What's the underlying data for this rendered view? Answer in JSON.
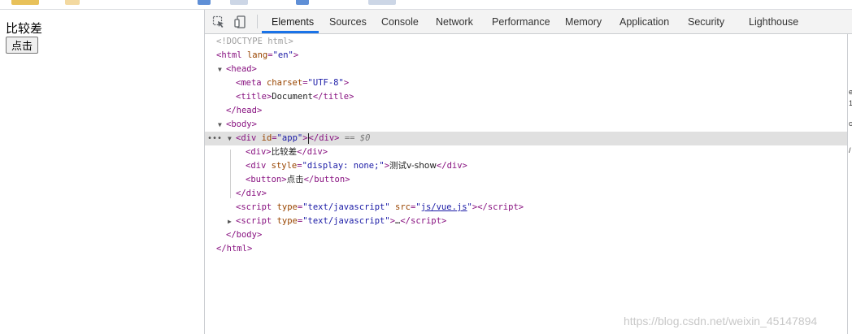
{
  "page": {
    "text": "比较差",
    "button_label": "点击"
  },
  "devtools": {
    "tabs": [
      "Elements",
      "Sources",
      "Console",
      "Network",
      "Performance",
      "Memory",
      "Application",
      "Security",
      "Lighthouse"
    ],
    "active_tab": "Elements",
    "tool_icons": [
      "inspect-element-icon",
      "device-toolbar-icon"
    ]
  },
  "dom": {
    "doctype": "<!DOCTYPE html>",
    "html_open_tag": "html",
    "html_lang_attr": "lang",
    "html_lang_val": "\"en\"",
    "head": "head",
    "meta_tag": "meta",
    "meta_attr": "charset",
    "meta_val": "\"UTF-8\"",
    "title_tag": "title",
    "title_text": "Document",
    "body": "body",
    "div_tag": "div",
    "div_id_attr": "id",
    "div_id_val": "\"app\"",
    "selected_marker": "== $0",
    "child1_text": "比较差",
    "child2_style_attr": "style",
    "child2_style_val": "\"display: none;\"",
    "child2_text": "测试v-show",
    "button_tag": "button",
    "button_text": "点击",
    "script_tag": "script",
    "script_type_attr": "type",
    "script_type_val": "\"text/javascript\"",
    "script_src_attr": "src",
    "script_src_val": "js/vue.js",
    "ellipsis": "…"
  },
  "watermark": "https://blog.csdn.net/weixin_45147894",
  "colors": {
    "tag": "#881280",
    "attr_name": "#994500",
    "attr_value": "#1a1aa6",
    "active_tab_underline": "#1a73e8",
    "selected_row": "#e0e0e0"
  }
}
